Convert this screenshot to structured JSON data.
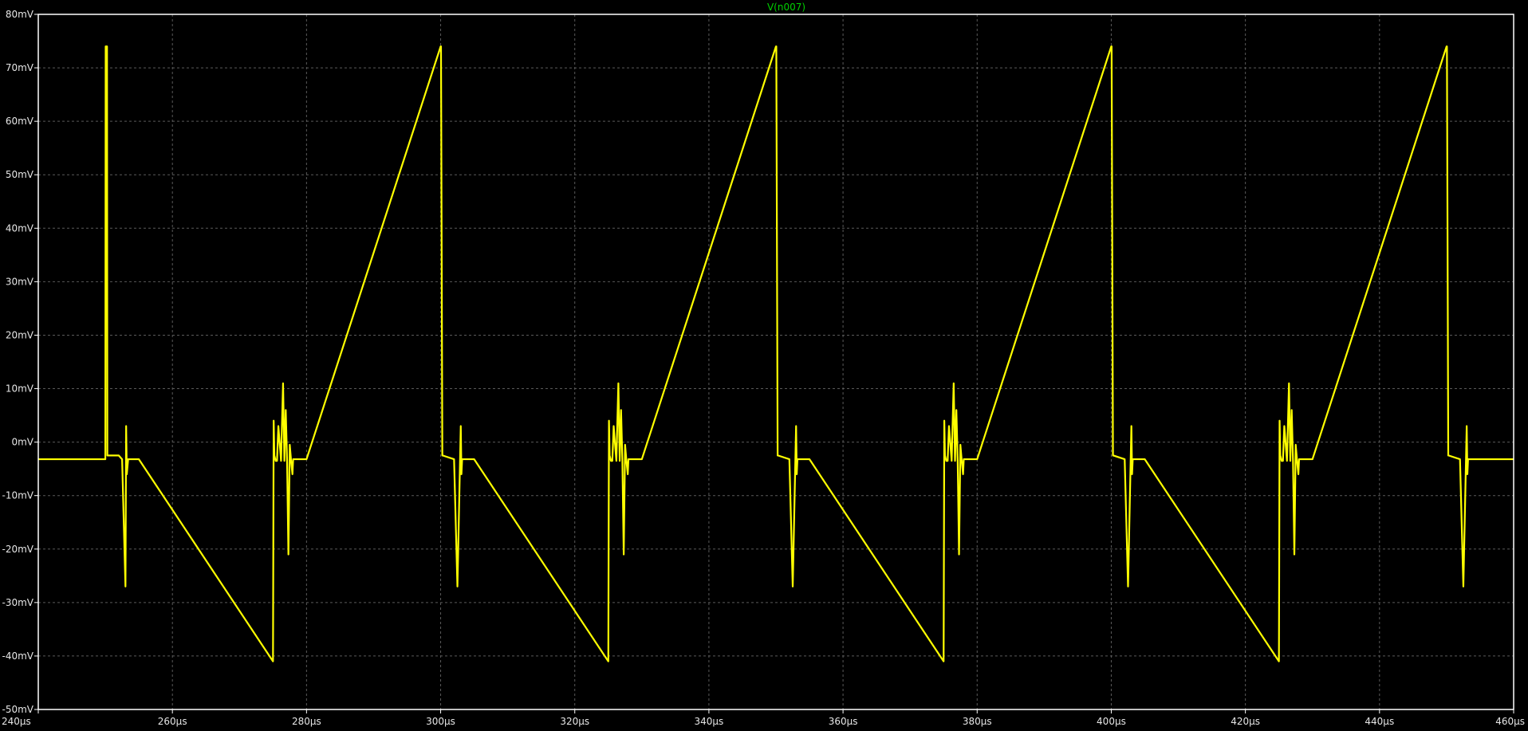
{
  "colors": {
    "background": "#000000",
    "frame": "#ffffff",
    "grid": "#5a5a5a",
    "trace": "#ffff00",
    "title": "#00d000",
    "tick_text": "#e6e6e6"
  },
  "chart_data": {
    "type": "line",
    "title": "V(n007)",
    "xlabel": "",
    "ylabel": "",
    "x_unit": "µs",
    "y_unit": "mV",
    "xlim": [
      240,
      460
    ],
    "ylim": [
      -50,
      80
    ],
    "grid": true,
    "legend": "none",
    "x_ticks": [
      240,
      260,
      280,
      300,
      320,
      340,
      360,
      380,
      400,
      420,
      440,
      460
    ],
    "x_tick_labels": [
      "240µs",
      "260µs",
      "280µs",
      "300µs",
      "320µs",
      "340µs",
      "360µs",
      "380µs",
      "400µs",
      "420µs",
      "440µs",
      "460µs"
    ],
    "y_ticks": [
      80,
      70,
      60,
      50,
      40,
      30,
      20,
      10,
      0,
      -10,
      -20,
      -30,
      -40,
      -50
    ],
    "y_tick_labels": [
      "80mV",
      "70mV",
      "60mV",
      "50mV",
      "40mV",
      "30mV",
      "20mV",
      "10mV",
      "0mV",
      "-10mV",
      "-20mV",
      "-30mV",
      "-40mV",
      "-50mV"
    ],
    "series": [
      {
        "values_note_free": true,
        "x": [
          240,
          250.0,
          250.05,
          250.25,
          250.3,
          252.0,
          252.5,
          253.0,
          253.1,
          253.2,
          253.4,
          253.6,
          255.0,
          275.0,
          275.1,
          275.2,
          275.4,
          275.6,
          275.8,
          276.2,
          276.5,
          276.7,
          276.9,
          277.1,
          277.3,
          277.5,
          277.7,
          277.9,
          278.0,
          278.15,
          278.4,
          280.0,
          300.0,
          300.05,
          300.25,
          300.3,
          302.0,
          302.5,
          303.0,
          303.1,
          303.2,
          303.4,
          303.6,
          305.0,
          325.0,
          325.1,
          325.2,
          325.4,
          325.6,
          325.8,
          326.2,
          326.5,
          326.7,
          326.9,
          327.1,
          327.3,
          327.5,
          327.7,
          327.9,
          328.0,
          328.15,
          328.4,
          330.0,
          350.0,
          350.05,
          350.25,
          350.3,
          352.0,
          352.5,
          353.0,
          353.1,
          353.2,
          353.4,
          353.6,
          355.0,
          375.0,
          375.1,
          375.2,
          375.4,
          375.6,
          375.8,
          376.2,
          376.5,
          376.7,
          376.9,
          377.1,
          377.3,
          377.5,
          377.7,
          377.9,
          378.0,
          378.15,
          378.4,
          380.0,
          400.0,
          400.05,
          400.25,
          400.3,
          402.0,
          402.5,
          403.0,
          403.1,
          403.2,
          403.4,
          403.6,
          405.0,
          425.0,
          425.1,
          425.2,
          425.4,
          425.6,
          425.8,
          426.2,
          426.5,
          426.7,
          426.9,
          427.1,
          427.3,
          427.5,
          427.7,
          427.9,
          428.0,
          428.15,
          428.4,
          430.0,
          450.0,
          450.05,
          450.25,
          450.3,
          452.0,
          452.5,
          453.0,
          453.1,
          453.2,
          453.4,
          453.6,
          455.0,
          460
        ],
        "y": [
          -3.2,
          -3.2,
          74,
          74,
          -2.5,
          -2.5,
          -3.2,
          -27,
          3,
          -6,
          -3.2,
          -3.2,
          -3.2,
          -41,
          4,
          -2.5,
          -3.5,
          -3.5,
          3,
          -3.5,
          11,
          -3.5,
          6,
          -3.5,
          -21,
          -0.5,
          -3.5,
          -6,
          -3.2,
          -3.2,
          -3.2,
          -3.2,
          74,
          74,
          -2.5,
          -2.5,
          -3.2,
          -27,
          3,
          -6,
          -3.2,
          -3.2,
          -3.2,
          -3.2,
          -41,
          4,
          -2.5,
          -3.5,
          -3.5,
          3,
          -3.5,
          11,
          -3.5,
          6,
          -3.5,
          -21,
          -0.5,
          -3.5,
          -6,
          -3.2,
          -3.2,
          -3.2,
          -3.2,
          74,
          74,
          -2.5,
          -2.5,
          -3.2,
          -27,
          3,
          -6,
          -3.2,
          -3.2,
          -3.2,
          -3.2,
          -41,
          4,
          -2.5,
          -3.5,
          -3.5,
          3,
          -3.5,
          11,
          -3.5,
          6,
          -3.5,
          -21,
          -0.5,
          -3.5,
          -6,
          -3.2,
          -3.2,
          -3.2,
          -3.2,
          74,
          74,
          -2.5,
          -2.5,
          -3.2,
          -27,
          3,
          -6,
          -3.2,
          -3.2,
          -3.2,
          -3.2,
          -41,
          4,
          -2.5,
          -3.5,
          -3.5,
          3,
          -3.5,
          11,
          -3.5,
          6,
          -3.5,
          -21,
          -0.5,
          -3.5,
          -6,
          -3.2,
          -3.2,
          -3.2,
          -3.2,
          74,
          74,
          -2.5,
          -2.5,
          -3.2,
          -27,
          3,
          -6,
          -3.2,
          -3.2,
          -3.2,
          -3.2,
          -3.2
        ]
      }
    ]
  }
}
